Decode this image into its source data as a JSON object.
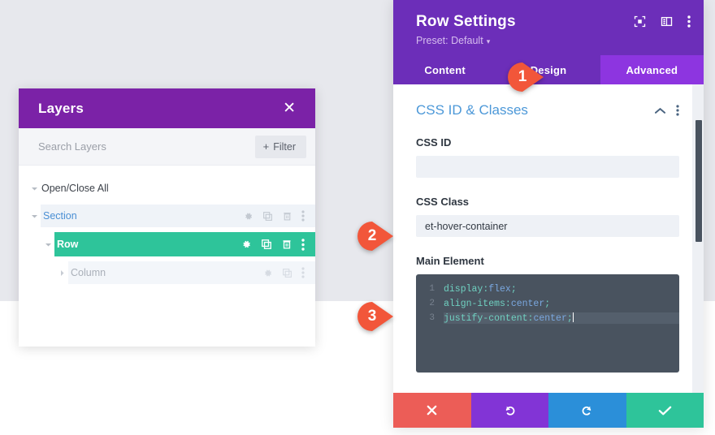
{
  "layers_panel": {
    "title": "Layers",
    "close_icon": "close-icon",
    "search": {
      "placeholder": "Search Layers",
      "value": ""
    },
    "filter_button": {
      "plus": "+",
      "label": "Filter"
    },
    "tree": [
      {
        "label": "Open/Close All",
        "level": 0,
        "expanded": true,
        "icons": []
      },
      {
        "label": "Section",
        "level": 1,
        "expanded": true,
        "icons": [
          "gear-icon",
          "duplicate-icon",
          "trash-icon",
          "more-icon"
        ]
      },
      {
        "label": "Row",
        "level": 2,
        "expanded": true,
        "selected": true,
        "icons": [
          "gear-icon",
          "duplicate-icon",
          "trash-icon",
          "more-icon"
        ]
      },
      {
        "label": "Column",
        "level": 3,
        "expanded": false,
        "icons": [
          "gear-icon",
          "duplicate-icon",
          "more-icon"
        ]
      }
    ]
  },
  "settings_panel": {
    "title": "Row Settings",
    "preset": "Preset: Default",
    "preset_caret": "▾",
    "header_icons": [
      "focus-frame-icon",
      "panel-layout-icon",
      "more-icon"
    ],
    "tabs": [
      {
        "label": "Content",
        "active": false
      },
      {
        "label": "Design",
        "active": false
      },
      {
        "label": "Advanced",
        "active": true
      }
    ],
    "section": {
      "title": "CSS ID & Classes",
      "collapse_icon": "chevron-up-icon",
      "more_icon": "more-icon"
    },
    "fields": [
      {
        "label": "CSS ID",
        "value": "",
        "placeholder": ""
      },
      {
        "label": "CSS Class",
        "value": "et-hover-container",
        "placeholder": ""
      }
    ],
    "code_field": {
      "label": "Main Element",
      "lines": [
        {
          "num": "1",
          "prop": "display",
          "colon": ":",
          "value": "flex",
          "semi": ";",
          "active": false
        },
        {
          "num": "2",
          "prop": "align-items",
          "colon": ":",
          "value": "center",
          "semi": ";",
          "active": false
        },
        {
          "num": "3",
          "prop": "justify-content",
          "colon": ":",
          "value": "center",
          "semi": ";",
          "active": true
        }
      ]
    },
    "actions": [
      {
        "name": "cancel",
        "icon": "close-icon",
        "color": "#ec5d57"
      },
      {
        "name": "undo",
        "icon": "undo-icon",
        "color": "#8234d6"
      },
      {
        "name": "redo",
        "icon": "redo-icon",
        "color": "#2b8fd9"
      },
      {
        "name": "save",
        "icon": "check-icon",
        "color": "#2ec49a"
      }
    ]
  },
  "callouts": [
    {
      "number": "1"
    },
    {
      "number": "2"
    },
    {
      "number": "3"
    }
  ],
  "colors": {
    "layers_header": "#7b22a7",
    "settings_header": "#6c2eb9",
    "tab_active": "#8d35e0",
    "row_selected": "#2ec49a",
    "section_text": "#4a8fd4",
    "callout": "#f2563a",
    "code_bg": "#49535f"
  }
}
